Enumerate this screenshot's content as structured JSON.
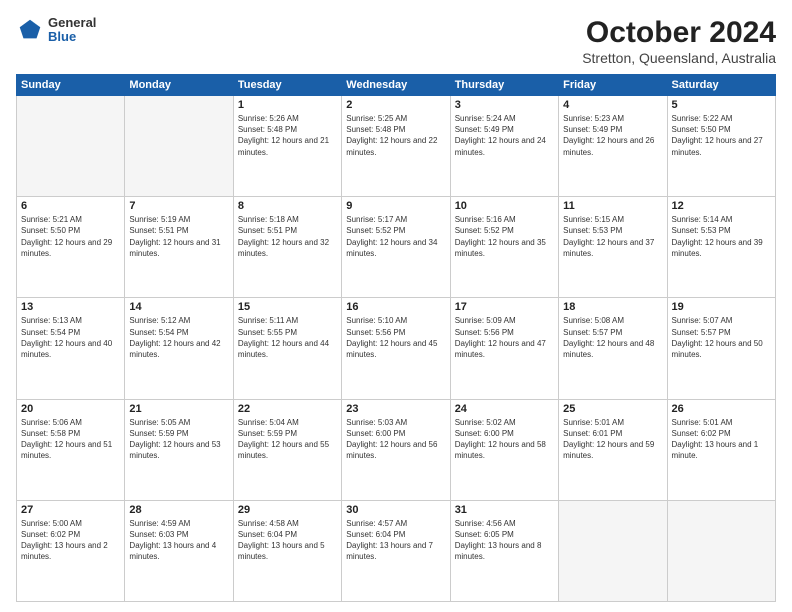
{
  "logo": {
    "general": "General",
    "blue": "Blue"
  },
  "header": {
    "month": "October 2024",
    "location": "Stretton, Queensland, Australia"
  },
  "weekdays": [
    "Sunday",
    "Monday",
    "Tuesday",
    "Wednesday",
    "Thursday",
    "Friday",
    "Saturday"
  ],
  "weeks": [
    [
      {
        "day": "",
        "empty": true
      },
      {
        "day": "",
        "empty": true
      },
      {
        "day": "1",
        "sunrise": "Sunrise: 5:26 AM",
        "sunset": "Sunset: 5:48 PM",
        "daylight": "Daylight: 12 hours and 21 minutes."
      },
      {
        "day": "2",
        "sunrise": "Sunrise: 5:25 AM",
        "sunset": "Sunset: 5:48 PM",
        "daylight": "Daylight: 12 hours and 22 minutes."
      },
      {
        "day": "3",
        "sunrise": "Sunrise: 5:24 AM",
        "sunset": "Sunset: 5:49 PM",
        "daylight": "Daylight: 12 hours and 24 minutes."
      },
      {
        "day": "4",
        "sunrise": "Sunrise: 5:23 AM",
        "sunset": "Sunset: 5:49 PM",
        "daylight": "Daylight: 12 hours and 26 minutes."
      },
      {
        "day": "5",
        "sunrise": "Sunrise: 5:22 AM",
        "sunset": "Sunset: 5:50 PM",
        "daylight": "Daylight: 12 hours and 27 minutes."
      }
    ],
    [
      {
        "day": "6",
        "sunrise": "Sunrise: 5:21 AM",
        "sunset": "Sunset: 5:50 PM",
        "daylight": "Daylight: 12 hours and 29 minutes."
      },
      {
        "day": "7",
        "sunrise": "Sunrise: 5:19 AM",
        "sunset": "Sunset: 5:51 PM",
        "daylight": "Daylight: 12 hours and 31 minutes."
      },
      {
        "day": "8",
        "sunrise": "Sunrise: 5:18 AM",
        "sunset": "Sunset: 5:51 PM",
        "daylight": "Daylight: 12 hours and 32 minutes."
      },
      {
        "day": "9",
        "sunrise": "Sunrise: 5:17 AM",
        "sunset": "Sunset: 5:52 PM",
        "daylight": "Daylight: 12 hours and 34 minutes."
      },
      {
        "day": "10",
        "sunrise": "Sunrise: 5:16 AM",
        "sunset": "Sunset: 5:52 PM",
        "daylight": "Daylight: 12 hours and 35 minutes."
      },
      {
        "day": "11",
        "sunrise": "Sunrise: 5:15 AM",
        "sunset": "Sunset: 5:53 PM",
        "daylight": "Daylight: 12 hours and 37 minutes."
      },
      {
        "day": "12",
        "sunrise": "Sunrise: 5:14 AM",
        "sunset": "Sunset: 5:53 PM",
        "daylight": "Daylight: 12 hours and 39 minutes."
      }
    ],
    [
      {
        "day": "13",
        "sunrise": "Sunrise: 5:13 AM",
        "sunset": "Sunset: 5:54 PM",
        "daylight": "Daylight: 12 hours and 40 minutes."
      },
      {
        "day": "14",
        "sunrise": "Sunrise: 5:12 AM",
        "sunset": "Sunset: 5:54 PM",
        "daylight": "Daylight: 12 hours and 42 minutes."
      },
      {
        "day": "15",
        "sunrise": "Sunrise: 5:11 AM",
        "sunset": "Sunset: 5:55 PM",
        "daylight": "Daylight: 12 hours and 44 minutes."
      },
      {
        "day": "16",
        "sunrise": "Sunrise: 5:10 AM",
        "sunset": "Sunset: 5:56 PM",
        "daylight": "Daylight: 12 hours and 45 minutes."
      },
      {
        "day": "17",
        "sunrise": "Sunrise: 5:09 AM",
        "sunset": "Sunset: 5:56 PM",
        "daylight": "Daylight: 12 hours and 47 minutes."
      },
      {
        "day": "18",
        "sunrise": "Sunrise: 5:08 AM",
        "sunset": "Sunset: 5:57 PM",
        "daylight": "Daylight: 12 hours and 48 minutes."
      },
      {
        "day": "19",
        "sunrise": "Sunrise: 5:07 AM",
        "sunset": "Sunset: 5:57 PM",
        "daylight": "Daylight: 12 hours and 50 minutes."
      }
    ],
    [
      {
        "day": "20",
        "sunrise": "Sunrise: 5:06 AM",
        "sunset": "Sunset: 5:58 PM",
        "daylight": "Daylight: 12 hours and 51 minutes."
      },
      {
        "day": "21",
        "sunrise": "Sunrise: 5:05 AM",
        "sunset": "Sunset: 5:59 PM",
        "daylight": "Daylight: 12 hours and 53 minutes."
      },
      {
        "day": "22",
        "sunrise": "Sunrise: 5:04 AM",
        "sunset": "Sunset: 5:59 PM",
        "daylight": "Daylight: 12 hours and 55 minutes."
      },
      {
        "day": "23",
        "sunrise": "Sunrise: 5:03 AM",
        "sunset": "Sunset: 6:00 PM",
        "daylight": "Daylight: 12 hours and 56 minutes."
      },
      {
        "day": "24",
        "sunrise": "Sunrise: 5:02 AM",
        "sunset": "Sunset: 6:00 PM",
        "daylight": "Daylight: 12 hours and 58 minutes."
      },
      {
        "day": "25",
        "sunrise": "Sunrise: 5:01 AM",
        "sunset": "Sunset: 6:01 PM",
        "daylight": "Daylight: 12 hours and 59 minutes."
      },
      {
        "day": "26",
        "sunrise": "Sunrise: 5:01 AM",
        "sunset": "Sunset: 6:02 PM",
        "daylight": "Daylight: 13 hours and 1 minute."
      }
    ],
    [
      {
        "day": "27",
        "sunrise": "Sunrise: 5:00 AM",
        "sunset": "Sunset: 6:02 PM",
        "daylight": "Daylight: 13 hours and 2 minutes."
      },
      {
        "day": "28",
        "sunrise": "Sunrise: 4:59 AM",
        "sunset": "Sunset: 6:03 PM",
        "daylight": "Daylight: 13 hours and 4 minutes."
      },
      {
        "day": "29",
        "sunrise": "Sunrise: 4:58 AM",
        "sunset": "Sunset: 6:04 PM",
        "daylight": "Daylight: 13 hours and 5 minutes."
      },
      {
        "day": "30",
        "sunrise": "Sunrise: 4:57 AM",
        "sunset": "Sunset: 6:04 PM",
        "daylight": "Daylight: 13 hours and 7 minutes."
      },
      {
        "day": "31",
        "sunrise": "Sunrise: 4:56 AM",
        "sunset": "Sunset: 6:05 PM",
        "daylight": "Daylight: 13 hours and 8 minutes."
      },
      {
        "day": "",
        "empty": true
      },
      {
        "day": "",
        "empty": true
      }
    ]
  ]
}
